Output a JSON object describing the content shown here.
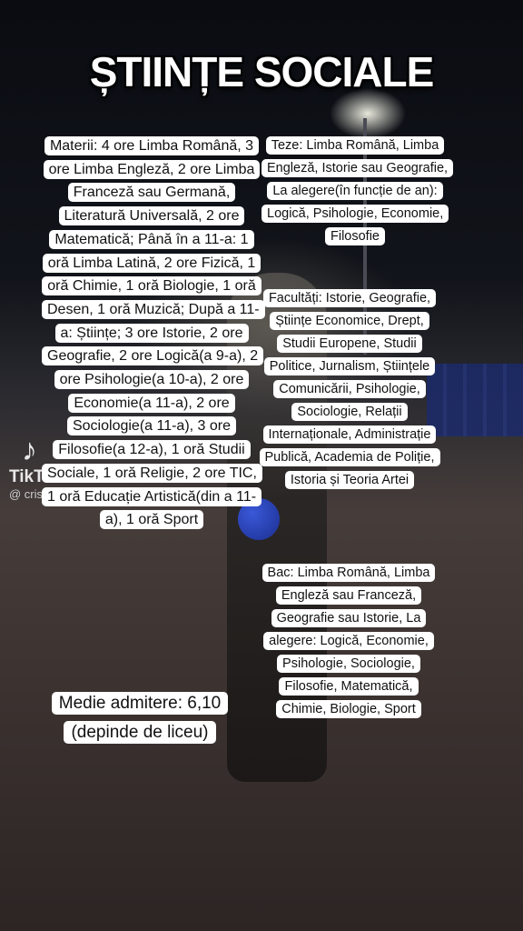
{
  "title": "ȘTIINȚE SOCIALE",
  "materii": "Materii: 4 ore Limba Română, 3 ore Limba Engleză, 2 ore Limba Franceză sau Germană, Literatură Universală, 2 ore Matematică; Până în a 11-a: 1 oră Limba Latină, 2 ore Fizică, 1 oră Chimie, 1 oră Biologie, 1 oră Desen, 1 oră Muzică; După a 11-a: Științe; 3 ore Istorie, 2 ore Geografie, 2 ore Logică(a 9-a), 2 ore Psihologie(a 10-a), 2 ore Economie(a 11-a), 2 ore Sociologie(a 11-a), 3 ore Filosofie(a 12-a), 1 oră Studii Sociale, 1 oră Religie, 2 ore TIC, 1 oră Educație Artistică(din a 11-a), 1 oră Sport",
  "medie": "Medie admitere: 6,10 (depinde de liceu)",
  "teze": "Teze: Limba Română, Limba Engleză, Istorie sau Geografie, La alegere(în funcție de an): Logică, Psihologie, Economie, Filosofie",
  "facultati": "Facultăți: Istorie, Geografie, Științe Economice, Drept, Studii Europene, Studii Politice, Jurnalism, Științele Comunicării, Psihologie, Sociologie, Relații Internaționale, Administrație Publică, Academia de Poliție, Istoria și Teoria Artei",
  "bac": "Bac: Limba Română, Limba Engleză sau Franceză, Geografie sau Istorie, La alegere: Logică, Economie, Psihologie, Sociologie, Filosofie, Matematică, Chimie, Biologie, Sport",
  "watermark": {
    "brand": "TikTok",
    "user": "@ cristi",
    "logo_icon": "tiktok-logo-icon"
  }
}
